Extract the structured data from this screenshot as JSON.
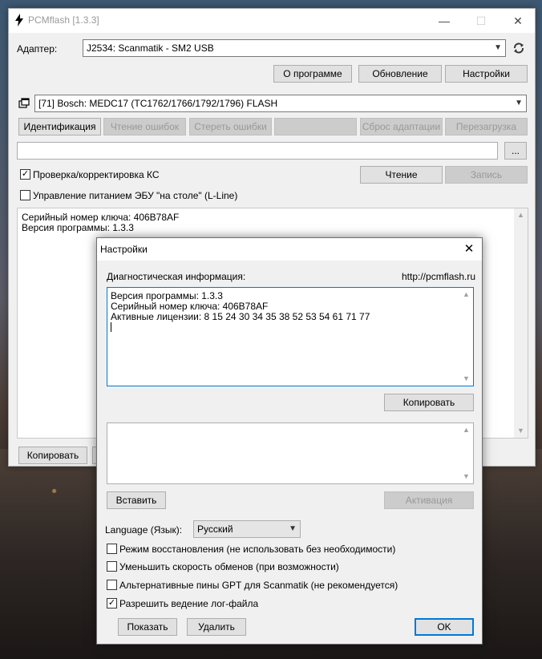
{
  "window": {
    "title": "PCMflash [1.3.3]",
    "minimize": "—",
    "maximize": "☐",
    "close": "✕"
  },
  "adapter": {
    "label": "Адаптер:",
    "value": "J2534: Scanmatik - SM2 USB"
  },
  "top_buttons": [
    "О программе",
    "Обновление",
    "Настройки"
  ],
  "module": {
    "value": "[71] Bosch: MEDC17 (TC1762/1766/1792/1796) FLASH"
  },
  "action_buttons": [
    "Идентификация",
    "Чтение ошибок",
    "Стереть ошибки",
    "",
    "Сброс адаптации",
    "Перезагрузка"
  ],
  "file": {
    "path": "",
    "browse": "..."
  },
  "checksum": {
    "label": "Проверка/корректировка КС",
    "checked": true
  },
  "read_button": "Чтение",
  "write_button": "Запись",
  "power": {
    "label": "Управление питанием ЭБУ \"на столе\" (L-Line)",
    "checked": false
  },
  "log": [
    "Серийный номер ключа: 406B78AF",
    "Версия программы: 1.3.3"
  ],
  "copy_button": "Копировать",
  "dialog": {
    "title": "Настройки",
    "diag_label": "Диагностическая информация:",
    "site": "http://pcmflash.ru",
    "info_lines": [
      "Версия программы: 1.3.3",
      "Серийный номер ключа: 406B78AF",
      "Активные лицензии: 8 15 24 30 34 35 38 52 53 54 61 71 77"
    ],
    "copy_button": "Копировать",
    "license_text": "",
    "paste_button": "Вставить",
    "activate_button": "Активация",
    "language_label": "Language (Язык):",
    "language_value": "Русский",
    "options": [
      {
        "label": "Режим восстановления (не использовать без необходимости)",
        "checked": false
      },
      {
        "label": "Уменьшить скорость обменов (при возможности)",
        "checked": false
      },
      {
        "label": "Альтернативные пины GPT для Scanmatik (не рекомендуется)",
        "checked": false
      },
      {
        "label": "Разрешить ведение лог-файла",
        "checked": true
      }
    ],
    "show_button": "Показать",
    "delete_button": "Удалить",
    "ok_button": "OK"
  },
  "colors": {
    "accent": "#0078d7",
    "window_bg": "#f0f0f0"
  }
}
